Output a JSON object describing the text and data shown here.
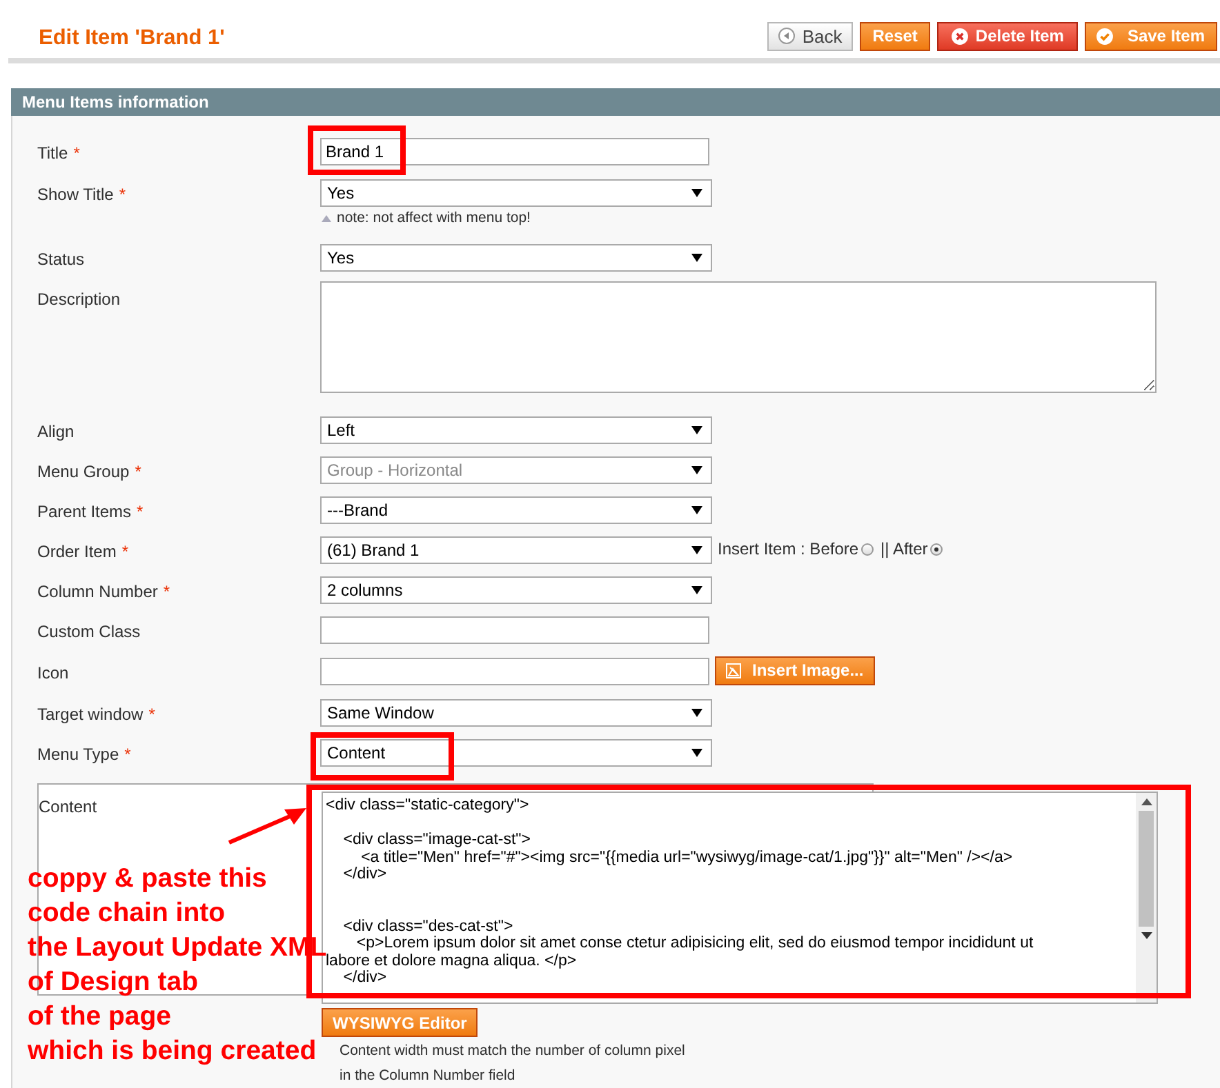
{
  "header": {
    "title": "Edit Item 'Brand 1'",
    "buttons": [
      {
        "label": "Back",
        "kind": "back"
      },
      {
        "label": "Reset",
        "kind": "reset"
      },
      {
        "label": "Delete Item",
        "kind": "delete"
      },
      {
        "label": "Save Item",
        "kind": "save"
      }
    ]
  },
  "section": {
    "title": "Menu Items information"
  },
  "fields": [
    {
      "label": "Title",
      "required_mark": "*",
      "kind": "text",
      "value": "Brand 1"
    },
    {
      "label": "Show Title",
      "required_mark": "*",
      "kind": "select",
      "value": "Yes",
      "note": "note: not affect with menu top!"
    },
    {
      "label": "Status",
      "kind": "select",
      "value": "Yes"
    },
    {
      "label": "Description",
      "kind": "textarea"
    },
    {
      "label": "Align",
      "kind": "select",
      "value": "Left"
    },
    {
      "label": "Menu Group",
      "required_mark": "*",
      "kind": "select",
      "value": "Group - Horizontal",
      "disabled": true
    },
    {
      "label": "Parent Items",
      "required_mark": "*",
      "kind": "select",
      "value": "---Brand"
    },
    {
      "label": "Order Item",
      "required_mark": "*",
      "kind": "select",
      "value": "(61) Brand 1",
      "radios": [
        {
          "label": "Insert Item : Before",
          "selected": false
        },
        {
          "label": "|| After",
          "selected": true
        }
      ]
    },
    {
      "label": "Column Number",
      "required_mark": "*",
      "kind": "select",
      "value": "2 columns"
    },
    {
      "label": "Custom Class",
      "kind": "text"
    },
    {
      "label": "Icon",
      "kind": "text",
      "button": "Insert Image..."
    },
    {
      "label": "Target window",
      "required_mark": "*",
      "kind": "select",
      "value": "Same Window"
    },
    {
      "label": "Menu Type",
      "required_mark": "*",
      "kind": "select",
      "value": "Content"
    },
    {
      "label": "Content",
      "kind": "editor",
      "value": "<div class=\"static-category\">\n\n    <div class=\"image-cat-st\">\n        <a title=\"Men\" href=\"#\"><img src=\"{{media url=\"wysiwyg/image-cat/1.jpg\"}}\" alt=\"Men\" /></a>\n    </div>\n\n\n    <div class=\"des-cat-st\">\n       <p>Lorem ipsum dolor sit amet conse ctetur adipisicing elit, sed do eiusmod tempor incididunt ut labore et dolore magna aliqua. </p>\n    </div>",
      "button": "WYSIWYG Editor",
      "note": "Content width must match the number of column pixel in the Column Number field"
    }
  ],
  "annotation": {
    "text": "coppy & paste this\ncode chain into\nthe Layout Update XML\nof Design tab\nof the page\nwhich is being created"
  }
}
